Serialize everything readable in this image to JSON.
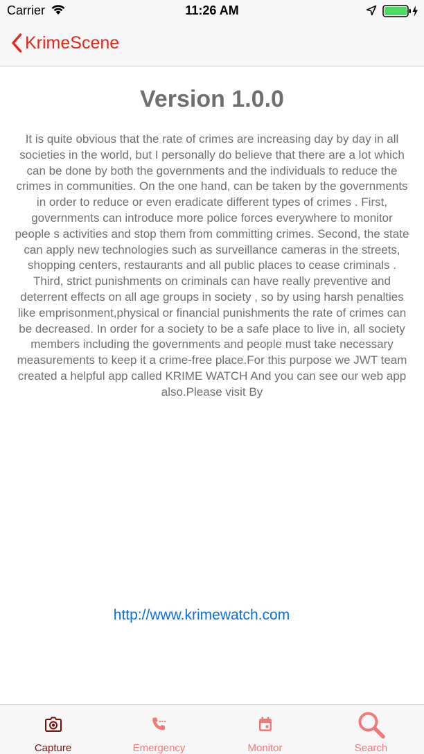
{
  "status_bar": {
    "carrier": "Carrier",
    "time": "11:26 AM",
    "icons": [
      "wifi-icon",
      "location-arrow-icon",
      "battery-charging-icon"
    ],
    "battery_color": "#4cd964"
  },
  "nav": {
    "back_label": "KrimeScene",
    "accent_color": "#e8271b"
  },
  "about": {
    "version": "Version 1.0.0",
    "body": "It is quite obvious that the rate of crimes are increasing day by day in all societies in the world, but I personally do believe that there are a lot which can be done by both the governments and the individuals to reduce the crimes in communities. On the one hand, can be taken by the governments in order to reduce or even eradicate different types of crimes . First, governments can introduce more police forces everywhere to monitor people s activities and stop them from committing crimes. Second, the state can apply new technologies such as surveillance cameras in the streets, shopping centers, restaurants and all public places to cease criminals . Third, strict punishments on criminals can have really preventive and deterrent effects on all age groups in society , so by using harsh penalties like emprisonment,physical or financial punishments the rate of crimes can be decreased. In order for a society to be a safe place to live in, all society members including the governments and people must take necessary measurements to keep it a crime-free place.For this purpose we JWT team created a helpful app called KRIME WATCH And you can see our web app also.Please visit By",
    "link": "http://www.krimewatch.com",
    "link_color": "#0a70e0"
  },
  "tabs": [
    {
      "label": "Capture",
      "icon": "camera-icon",
      "selected": true
    },
    {
      "label": "Emergency",
      "icon": "phone-icon",
      "selected": false
    },
    {
      "label": "Monitor",
      "icon": "calendar-icon",
      "selected": false
    },
    {
      "label": "Search",
      "icon": "search-icon",
      "selected": false
    }
  ]
}
